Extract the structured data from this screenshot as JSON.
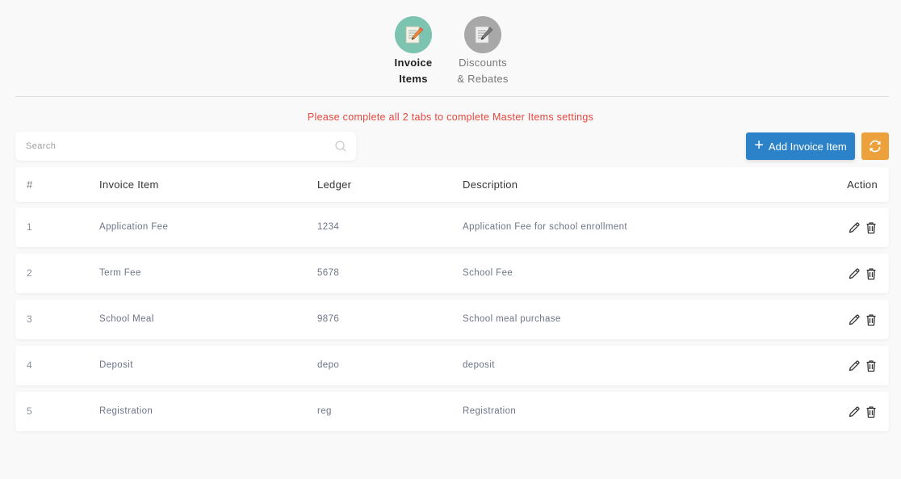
{
  "tabs": [
    {
      "label_line1": "Invoice",
      "label_line2": "Items",
      "icon": "document-edit-icon",
      "color": "#7cc3b0",
      "active": true
    },
    {
      "label_line1": "Discounts",
      "label_line2": "& Rebates",
      "icon": "document-edit-icon",
      "color": "#a8a8a8",
      "active": false
    }
  ],
  "notice": "Please complete all 2 tabs to complete Master Items settings",
  "search": {
    "placeholder": "Search",
    "value": ""
  },
  "toolbar": {
    "add_label": "Add Invoice Item",
    "add_color": "#2c82c9",
    "refresh_color": "#eca13d"
  },
  "table": {
    "headers": {
      "num": "#",
      "item": "Invoice Item",
      "ledger": "Ledger",
      "description": "Description",
      "action": "Action"
    },
    "rows": [
      {
        "num": "1",
        "item": "Application Fee",
        "ledger": "1234",
        "description": "Application Fee for school enrollment"
      },
      {
        "num": "2",
        "item": "Term Fee",
        "ledger": "5678",
        "description": "School Fee"
      },
      {
        "num": "3",
        "item": "School Meal",
        "ledger": "9876",
        "description": "School meal purchase"
      },
      {
        "num": "4",
        "item": "Deposit",
        "ledger": "depo",
        "description": "deposit"
      },
      {
        "num": "5",
        "item": "Registration",
        "ledger": "reg",
        "description": "Registration"
      }
    ]
  }
}
